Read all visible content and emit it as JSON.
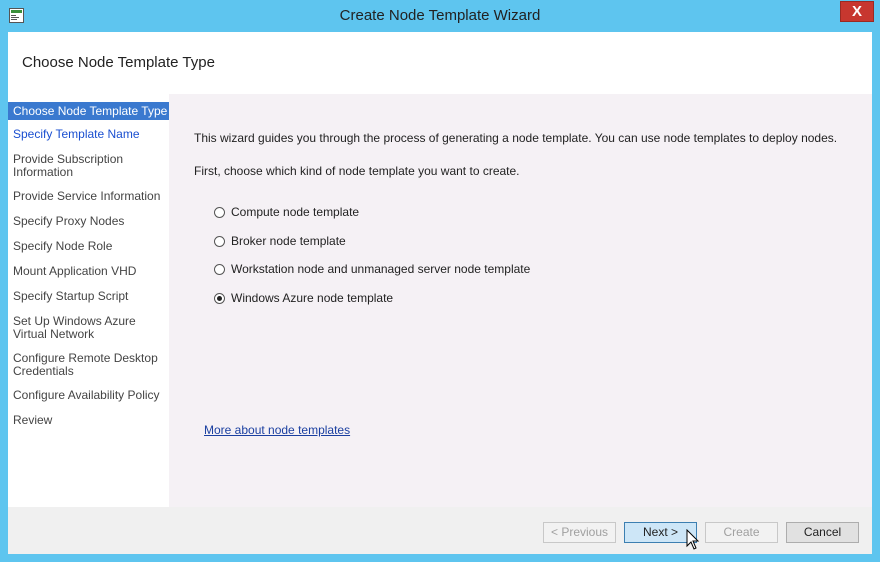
{
  "window": {
    "title": "Create Node Template Wizard",
    "close_glyph": "X"
  },
  "header": {
    "title": "Choose Node Template Type"
  },
  "sidebar": {
    "items": [
      {
        "label": "Choose Node Template Type",
        "state": "active"
      },
      {
        "label": "Specify Template Name",
        "state": "link"
      },
      {
        "label": "Provide Subscription\nInformation",
        "state": "normal"
      },
      {
        "label": "Provide Service Information",
        "state": "normal"
      },
      {
        "label": "Specify Proxy Nodes",
        "state": "normal"
      },
      {
        "label": "Specify Node Role",
        "state": "normal"
      },
      {
        "label": "Mount Application VHD",
        "state": "normal"
      },
      {
        "label": "Specify Startup Script",
        "state": "normal"
      },
      {
        "label": "Set Up Windows Azure\nVirtual Network",
        "state": "normal"
      },
      {
        "label": "Configure Remote Desktop\nCredentials",
        "state": "normal"
      },
      {
        "label": "Configure Availability Policy",
        "state": "normal"
      },
      {
        "label": "Review",
        "state": "normal"
      }
    ]
  },
  "main": {
    "intro": "This wizard guides you through the process of generating a node template. You can use node templates to deploy nodes.",
    "subintro": "First, choose which kind of node template you want to create.",
    "options": [
      {
        "label": "Compute node template",
        "checked": false
      },
      {
        "label": "Broker node template",
        "checked": false
      },
      {
        "label": "Workstation node and unmanaged server node template",
        "checked": false
      },
      {
        "label": "Windows Azure node template",
        "checked": true
      }
    ],
    "more_link": "More about node templates"
  },
  "footer": {
    "previous_label": "< Previous",
    "next_label": "Next >",
    "create_label": "Create",
    "cancel_label": "Cancel"
  },
  "colors": {
    "titlebar": "#5ec5ef",
    "active_nav": "#3a79cf",
    "close_button": "#c7372f",
    "content_bg": "#f5f1f5"
  }
}
